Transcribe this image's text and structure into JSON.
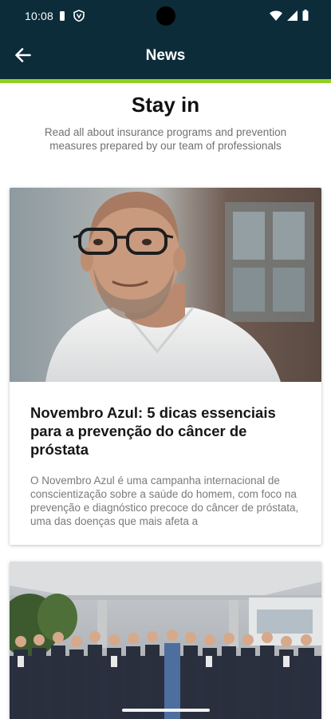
{
  "status_bar": {
    "time": "10:08"
  },
  "appbar": {
    "title": "News"
  },
  "intro": {
    "title": "Stay in",
    "subtitle": "Read all about insurance programs and prevention measures prepared by our team of professionals"
  },
  "articles": [
    {
      "title": "Novembro Azul: 5 dicas essenciais para a prevenção do câncer de próstata",
      "excerpt": "O Novembro Azul é uma campanha internacional de conscientização sobre a saúde do homem, com foco na prevenção e diagnóstico precoce do câncer de próstata, uma das doenças que mais afeta a"
    }
  ],
  "colors": {
    "header_bg": "#0c2c3a",
    "accent": "#8fd11f"
  }
}
